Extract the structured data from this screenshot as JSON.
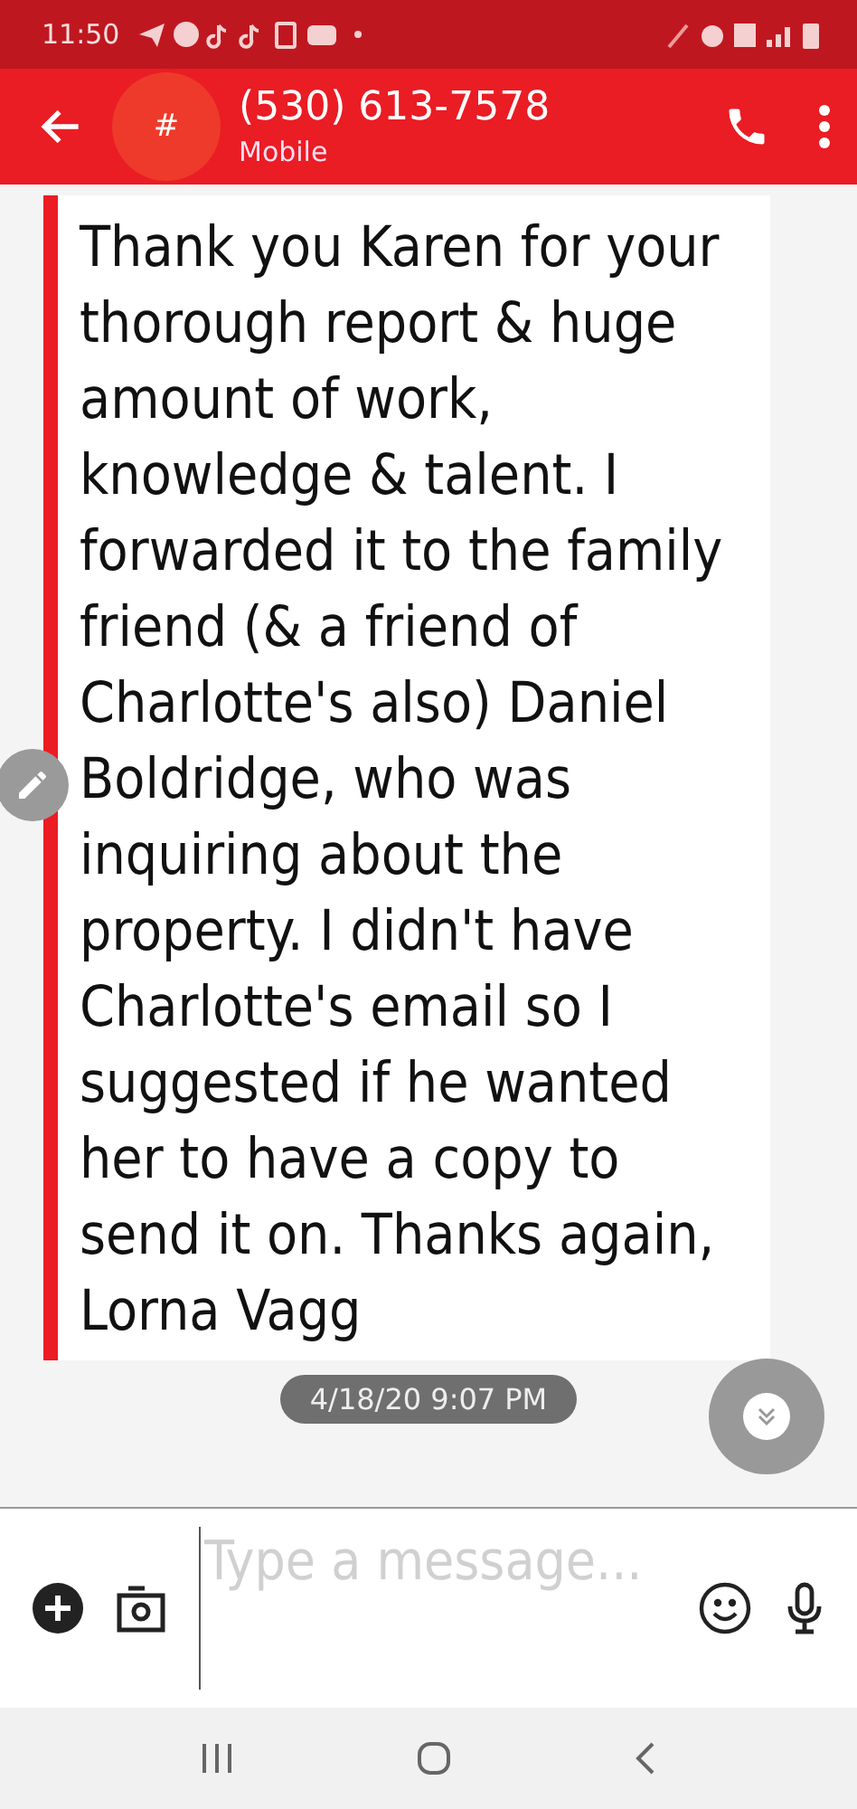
{
  "status_bar": {
    "time": "11:50"
  },
  "header": {
    "avatar": "#",
    "title": "(530) 613-7578",
    "subtitle": "Mobile"
  },
  "message": {
    "text": "Thank you Karen for your thorough report & huge amount of work, knowledge & talent. I forwarded it to the family friend (& a friend of Charlotte's also) Daniel Boldridge, who was inquiring about the property. I didn't have Charlotte's email so I suggested if he wanted her to have a copy to send it on. Thanks again, Lorna Vagg",
    "timestamp": "4/18/20 9:07 PM"
  },
  "composer": {
    "placeholder": "Type a message..."
  }
}
